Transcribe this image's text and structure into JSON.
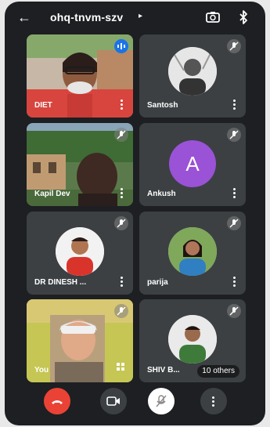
{
  "header": {
    "meeting_code": "ohq-tnvm-szv",
    "caret": "▸"
  },
  "tiles": [
    {
      "name": "DIET"
    },
    {
      "name": "Santosh"
    },
    {
      "name": "Kapil Dev"
    },
    {
      "name": "Ankush",
      "initial": "A"
    },
    {
      "name": "DR DINESH ..."
    },
    {
      "name": "parija"
    },
    {
      "name": "You"
    },
    {
      "name": "SHIV B..."
    }
  ],
  "overflow": {
    "label": "10 others"
  },
  "colors": {
    "end_call": "#ea4335",
    "avatar_purple": "#9a52d6",
    "speaking_blue": "#1a73e8",
    "tile_bg": "#3c4043",
    "screen_bg": "#1d1f22"
  }
}
